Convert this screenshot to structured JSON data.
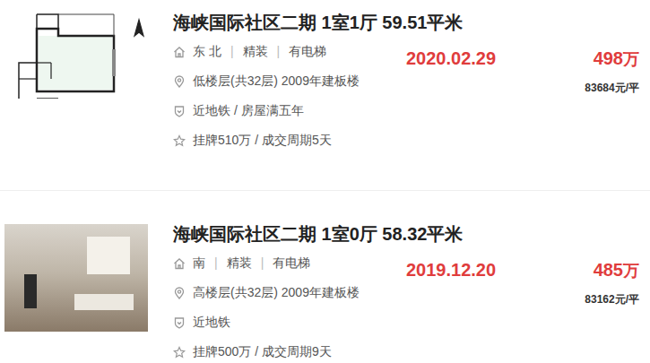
{
  "listings": [
    {
      "title": "海峡国际社区二期 1室1厅 59.51平米",
      "attributes": [
        "东 北",
        "精装",
        "有电梯"
      ],
      "attr_separator": "|",
      "floor_info": "低楼层(共32层) 2009年建板楼",
      "tags": "近地铁 / 房屋满五年",
      "deal": "挂牌510万 / 成交周期5天",
      "date": "2020.02.29",
      "price": "498",
      "price_unit": "万",
      "unit_price": "83684元/平",
      "image": {
        "kind": "floorplan"
      }
    },
    {
      "title": "海峡国际社区二期 1室0厅 58.32平米",
      "attributes": [
        "南",
        "精装",
        "有电梯"
      ],
      "attr_separator": "|",
      "floor_info": "高楼层(共32层) 2009年建板楼",
      "tags": "近地铁",
      "deal": "挂牌500万 / 成交周期9天",
      "date": "2019.12.20",
      "price": "485",
      "price_unit": "万",
      "unit_price": "83162元/平",
      "image": {
        "kind": "photo"
      }
    }
  ]
}
